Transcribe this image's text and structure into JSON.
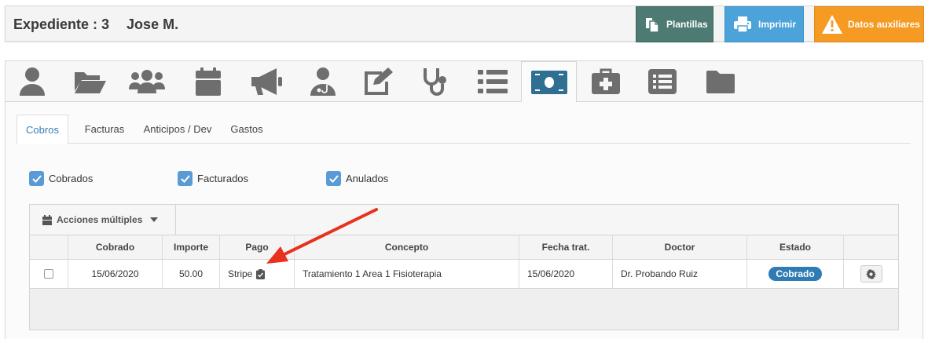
{
  "header": {
    "title_prefix": "Expediente : 3",
    "patient_name": "Jose M.",
    "buttons": {
      "plantillas": "Plantillas",
      "imprimir": "Imprimir",
      "datos_auxiliares": "Datos auxiliares"
    }
  },
  "icon_tabs": [
    {
      "icon": "user-icon"
    },
    {
      "icon": "folder-open-icon"
    },
    {
      "icon": "users-icon"
    },
    {
      "icon": "calendar-icon"
    },
    {
      "icon": "megaphone-icon"
    },
    {
      "icon": "doctor-icon"
    },
    {
      "icon": "edit-icon"
    },
    {
      "icon": "stethoscope-icon"
    },
    {
      "icon": "list-icon"
    },
    {
      "icon": "money-bill-icon",
      "active": true
    },
    {
      "icon": "medkit-icon"
    },
    {
      "icon": "list-alt-icon"
    },
    {
      "icon": "folder-icon"
    }
  ],
  "text_tabs": [
    {
      "label": "Cobros",
      "active": true
    },
    {
      "label": "Facturas"
    },
    {
      "label": "Anticipos / Dev"
    },
    {
      "label": "Gastos"
    }
  ],
  "filters": [
    {
      "label": "Cobrados",
      "checked": true
    },
    {
      "label": "Facturados",
      "checked": true
    },
    {
      "label": "Anulados",
      "checked": true
    }
  ],
  "actions": {
    "label": "Acciones múltiples"
  },
  "table": {
    "columns": [
      "",
      "Cobrado",
      "Importe",
      "Pago",
      "Concepto",
      "Fecha trat.",
      "Doctor",
      "Estado",
      ""
    ],
    "rows": [
      {
        "cobrado": "15/06/2020",
        "importe": "50.00",
        "pago": "Stripe",
        "concepto": "Tratamiento 1 Area 1 Fisioterapia",
        "fecha_trat": "15/06/2020",
        "doctor": "Dr. Probando Ruiz",
        "estado": "Cobrado"
      }
    ]
  },
  "colors": {
    "accent": "#2f7bb5",
    "plantillas": "#4d7a72",
    "imprimir": "#4ba3d9",
    "datos": "#f59a23",
    "arrow": "#e8311f"
  }
}
